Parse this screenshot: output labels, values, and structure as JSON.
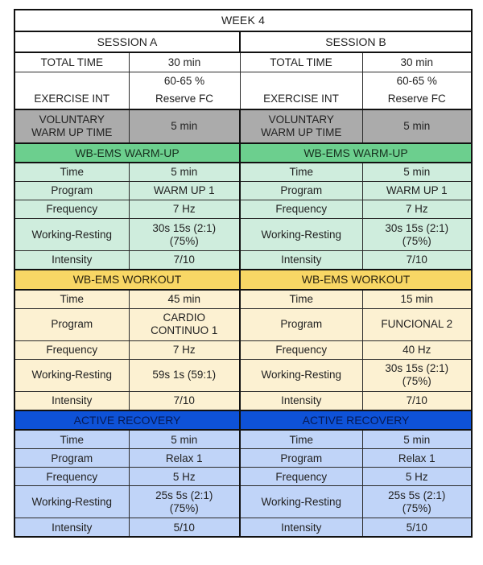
{
  "title": "WEEK 4",
  "colors": {
    "warmup_header": "#6ccf8e",
    "warmup_body": "#cfeddd",
    "workout_header": "#f8d765",
    "workout_body": "#fcf1d2",
    "recovery_header": "#0e52d8",
    "recovery_body": "#c0d4f8",
    "voluntary_row": "#ababab",
    "border": "#111111"
  },
  "sessions": {
    "a": {
      "name": "SESSION A",
      "summary": {
        "total_time_label": "TOTAL TIME",
        "total_time_value": "30 min",
        "exercise_int_label": "EXERCISE INT",
        "exercise_int_value_line1": "60-65 %",
        "exercise_int_value_line2": "Reserve FC"
      },
      "voluntary": {
        "label_line1": "VOLUNTARY",
        "label_line2": "WARM UP TIME",
        "value": "5 min"
      },
      "blocks": [
        {
          "header": "WB-EMS WARM-UP",
          "rows": [
            {
              "label": "Time",
              "value": "5 min"
            },
            {
              "label": "Program",
              "value": "WARM UP 1"
            },
            {
              "label": "Frequency",
              "value": "7 Hz"
            },
            {
              "label": "Working-Resting",
              "value_line1": "30s 15s (2:1)",
              "value_line2": "(75%)"
            },
            {
              "label": "Intensity",
              "value": "7/10"
            }
          ]
        },
        {
          "header": "WB-EMS WORKOUT",
          "rows": [
            {
              "label": "Time",
              "value": "45 min"
            },
            {
              "label": "Program",
              "value_line1": "CARDIO",
              "value_line2": "CONTINUO 1"
            },
            {
              "label": "Frequency",
              "value": "7 Hz"
            },
            {
              "label": "Working-Resting",
              "value": "59s 1s (59:1)"
            },
            {
              "label": "Intensity",
              "value": "7/10"
            }
          ]
        },
        {
          "header": "ACTIVE RECOVERY",
          "rows": [
            {
              "label": "Time",
              "value": "5 min"
            },
            {
              "label": "Program",
              "value": "Relax 1"
            },
            {
              "label": "Frequency",
              "value": "5 Hz"
            },
            {
              "label": "Working-Resting",
              "value_line1": "25s 5s (2:1)",
              "value_line2": "(75%)"
            },
            {
              "label": "Intensity",
              "value": "5/10"
            }
          ]
        }
      ]
    },
    "b": {
      "name": "SESSION B",
      "summary": {
        "total_time_label": "TOTAL TIME",
        "total_time_value": "30 min",
        "exercise_int_label": "EXERCISE INT",
        "exercise_int_value_line1": "60-65 %",
        "exercise_int_value_line2": "Reserve FC"
      },
      "voluntary": {
        "label_line1": "VOLUNTARY",
        "label_line2": "WARM UP TIME",
        "value": "5 min"
      },
      "blocks": [
        {
          "header": "WB-EMS WARM-UP",
          "rows": [
            {
              "label": "Time",
              "value": "5 min"
            },
            {
              "label": "Program",
              "value": "WARM UP 1"
            },
            {
              "label": "Frequency",
              "value": "7 Hz"
            },
            {
              "label": "Working-Resting",
              "value_line1": "30s 15s (2:1)",
              "value_line2": "(75%)"
            },
            {
              "label": "Intensity",
              "value": "7/10"
            }
          ]
        },
        {
          "header": "WB-EMS WORKOUT",
          "rows": [
            {
              "label": "Time",
              "value": "15 min"
            },
            {
              "label": "Program",
              "value": "FUNCIONAL 2"
            },
            {
              "label": "Frequency",
              "value": "40 Hz"
            },
            {
              "label": "Working-Resting",
              "value_line1": "30s 15s (2:1)",
              "value_line2": "(75%)"
            },
            {
              "label": "Intensity",
              "value": "7/10"
            }
          ]
        },
        {
          "header": "ACTIVE RECOVERY",
          "rows": [
            {
              "label": "Time",
              "value": "5 min"
            },
            {
              "label": "Program",
              "value": "Relax 1"
            },
            {
              "label": "Frequency",
              "value": "5 Hz"
            },
            {
              "label": "Working-Resting",
              "value_line1": "25s 5s (2:1)",
              "value_line2": "(75%)"
            },
            {
              "label": "Intensity",
              "value": "5/10"
            }
          ]
        }
      ]
    }
  }
}
